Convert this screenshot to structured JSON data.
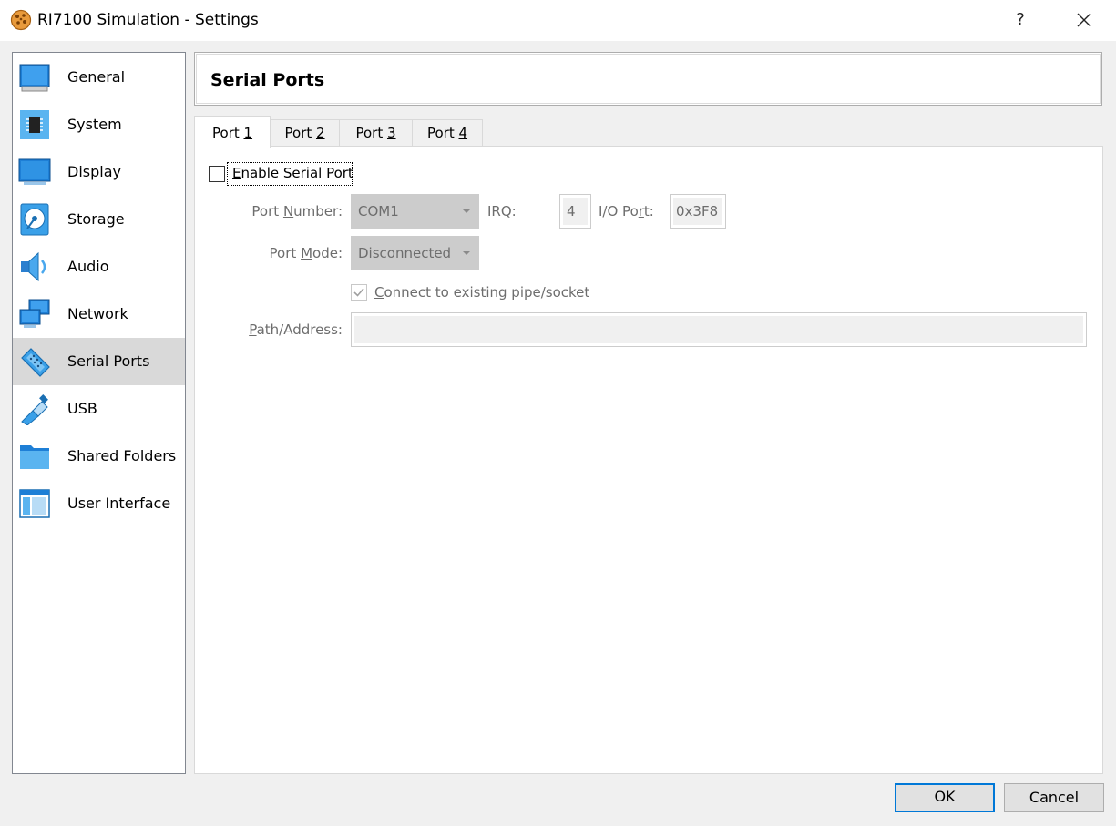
{
  "window": {
    "title": "RI7100 Simulation - Settings",
    "help_label": "?"
  },
  "sidebar": {
    "items": [
      {
        "label": "General",
        "icon": "general-icon",
        "selected": false
      },
      {
        "label": "System",
        "icon": "chip-icon",
        "selected": false
      },
      {
        "label": "Display",
        "icon": "monitor-icon",
        "selected": false
      },
      {
        "label": "Storage",
        "icon": "disk-icon",
        "selected": false
      },
      {
        "label": "Audio",
        "icon": "speaker-icon",
        "selected": false
      },
      {
        "label": "Network",
        "icon": "network-icon",
        "selected": false
      },
      {
        "label": "Serial Ports",
        "icon": "serial-connector-icon",
        "selected": true
      },
      {
        "label": "USB",
        "icon": "usb-icon",
        "selected": false
      },
      {
        "label": "Shared Folders",
        "icon": "folder-icon",
        "selected": false
      },
      {
        "label": "User Interface",
        "icon": "window-layout-icon",
        "selected": false
      }
    ]
  },
  "page": {
    "title": "Serial Ports"
  },
  "tabs": [
    {
      "prefix": "Port ",
      "accel": "1",
      "active": true
    },
    {
      "prefix": "Port ",
      "accel": "2",
      "active": false
    },
    {
      "prefix": "Port ",
      "accel": "3",
      "active": false
    },
    {
      "prefix": "Port ",
      "accel": "4",
      "active": false
    }
  ],
  "form": {
    "enable": {
      "accel": "E",
      "rest": "nable Serial Port",
      "checked": false
    },
    "port_number": {
      "label_pre": "Port ",
      "label_accel": "N",
      "label_post": "umber:",
      "value": "COM1"
    },
    "irq": {
      "label": "IRQ:",
      "value": "4"
    },
    "io_port": {
      "label_pre": "I/O Po",
      "label_accel": "r",
      "label_post": "t:",
      "value": "0x3F8"
    },
    "port_mode": {
      "label_pre": "Port ",
      "label_accel": "M",
      "label_post": "ode:",
      "value": "Disconnected"
    },
    "connect_existing": {
      "accel": "C",
      "rest": "onnect to existing pipe/socket",
      "checked": true
    },
    "path": {
      "label_accel": "P",
      "label_post": "ath/Address:",
      "value": ""
    }
  },
  "buttons": {
    "ok": "OK",
    "cancel": "Cancel"
  },
  "colors": {
    "accent": "#0078d7",
    "selected_item": "#d9d9d9",
    "disabled_text": "#6d6d6d"
  }
}
